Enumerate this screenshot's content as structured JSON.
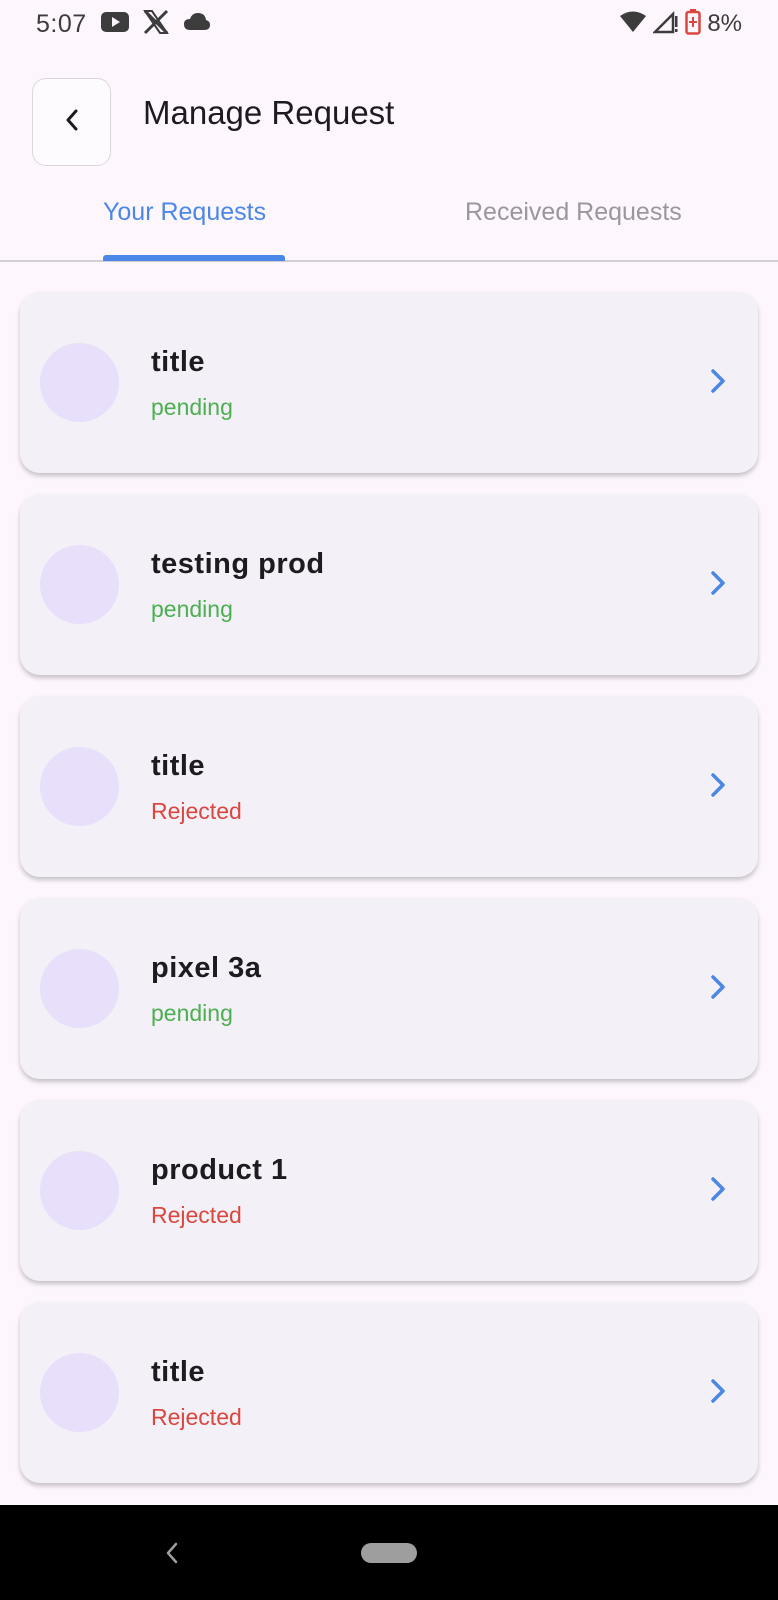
{
  "status_bar": {
    "time": "5:07",
    "icons_left": [
      "youtube-icon",
      "x-icon",
      "cloud-icon"
    ],
    "icons_right": [
      "wifi-icon",
      "signal-icon",
      "battery-icon"
    ],
    "battery": "8%"
  },
  "header": {
    "title": "Manage Request"
  },
  "tabs": [
    {
      "label": "Your Requests",
      "active": true
    },
    {
      "label": "Received Requests",
      "active": false
    }
  ],
  "requests": [
    {
      "title": "title",
      "status": "pending"
    },
    {
      "title": "testing prod",
      "status": "pending"
    },
    {
      "title": "title",
      "status": "Rejected"
    },
    {
      "title": "pixel 3a",
      "status": "pending"
    },
    {
      "title": "product 1",
      "status": "Rejected"
    },
    {
      "title": "title",
      "status": "Rejected"
    }
  ],
  "colors": {
    "accent": "#4a87e6",
    "pending": "#4caf50",
    "rejected": "#d9473f",
    "card_bg": "#F4F0F7",
    "avatar_bg": "#E8DFFA"
  }
}
